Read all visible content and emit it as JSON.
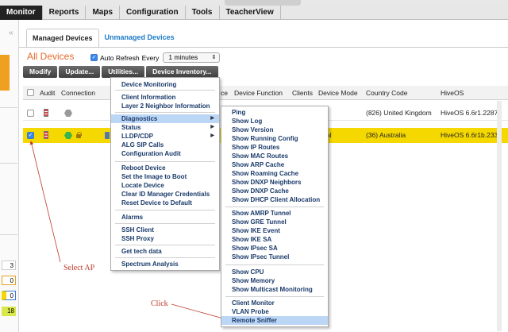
{
  "nav": {
    "items": [
      "Monitor",
      "Reports",
      "Maps",
      "Configuration",
      "Tools",
      "TeacherView"
    ],
    "active": "Monitor"
  },
  "tabs": [
    {
      "label": "Managed Devices",
      "active": true
    },
    {
      "label": "Unmanaged Devices",
      "active": false
    }
  ],
  "page_title": "All Devices",
  "refresh": {
    "label": "Auto Refresh",
    "checked": true,
    "every_label": "Every",
    "interval": "1 minutes"
  },
  "toolbar": [
    "Modify",
    "Update...",
    "Utilities...",
    "Device Inventory..."
  ],
  "columns": [
    "Audit",
    "Connection",
    "ce",
    "Device Function",
    "Clients",
    "Device Mode",
    "Country Code",
    "HiveOS"
  ],
  "rows": [
    {
      "checked": false,
      "device_mode": "",
      "country": "(826) United Kingdom",
      "hiveos": "HiveOS 6.6r1.2287"
    },
    {
      "checked": true,
      "device_mode": "al",
      "country": "(36) Australia",
      "hiveos": "HiveOS 6.6r1b.2338"
    }
  ],
  "sidebar_counts": [
    "3",
    "0",
    "0",
    "18"
  ],
  "utilities_menu": [
    "Device Monitoring",
    "Client Information",
    "Layer 2 Neighbor Information",
    "Diagnostics",
    "Status",
    "LLDP/CDP",
    "ALG SIP Calls",
    "Configuration Audit",
    "Reboot Device",
    "Set the Image to Boot",
    "Locate Device",
    "Clear ID Manager Credentials",
    "Reset Device to Default",
    "Alarms",
    "SSH Client",
    "SSH Proxy",
    "Get tech data",
    "Spectrum Analysis"
  ],
  "diagnostics_menu": [
    "Ping",
    "Show Log",
    "Show Version",
    "Show Running Config",
    "Show IP Routes",
    "Show MAC Routes",
    "Show ARP Cache",
    "Show Roaming Cache",
    "Show DNXP Neighbors",
    "Show DNXP Cache",
    "Show DHCP Client Allocation",
    "Show AMRP Tunnel",
    "Show GRE Tunnel",
    "Show IKE Event",
    "Show IKE SA",
    "Show IPsec SA",
    "Show IPsec Tunnel",
    "Show CPU",
    "Show Memory",
    "Show Multicast Monitoring",
    "Client Monitor",
    "VLAN Probe",
    "Remote Sniffer"
  ],
  "annotations": {
    "select_ap": "Select AP",
    "click": "Click"
  },
  "colors": {
    "highlight_row": "#f5d800",
    "menu_highlight": "#bcd6f5",
    "title": "#e46a2a",
    "annotation": "#c0392b"
  }
}
